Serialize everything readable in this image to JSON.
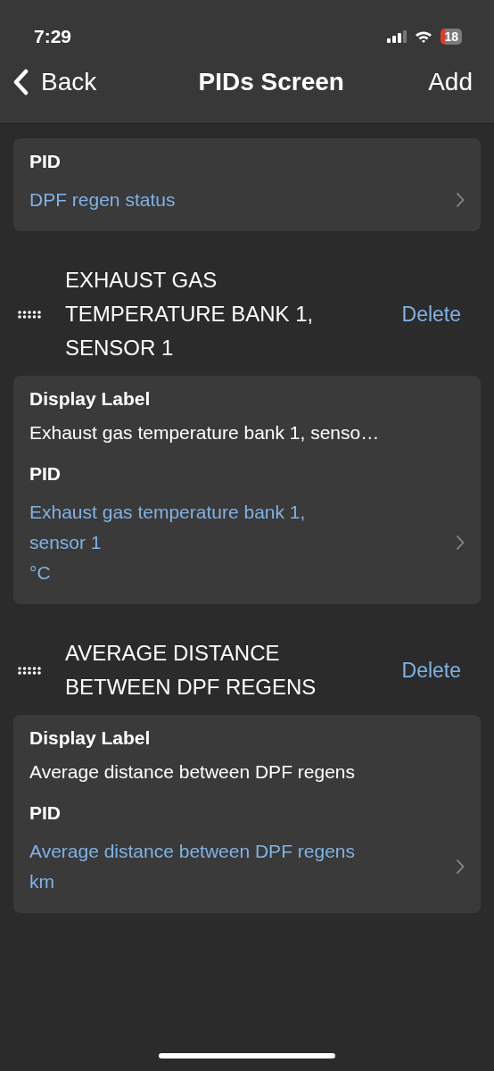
{
  "status_bar": {
    "time": "7:29",
    "battery": "18"
  },
  "nav": {
    "back": "Back",
    "title": "PIDs Screen",
    "action": "Add"
  },
  "sections": [
    {
      "fields": [
        {
          "kind": "link",
          "label": "PID",
          "lines": [
            "DPF regen status"
          ]
        }
      ]
    },
    {
      "title": "EXHAUST GAS TEMPERATURE BANK 1, SENSOR 1",
      "delete": "Delete",
      "fields": [
        {
          "kind": "text",
          "label": "Display Label",
          "value": "Exhaust gas temperature bank 1, senso…"
        },
        {
          "kind": "link",
          "label": "PID",
          "lines": [
            "Exhaust gas temperature bank 1,",
            "sensor 1",
            "°C"
          ]
        }
      ]
    },
    {
      "title": "AVERAGE DISTANCE BETWEEN DPF REGENS",
      "delete": "Delete",
      "fields": [
        {
          "kind": "text",
          "label": "Display Label",
          "value": "Average distance between DPF regens"
        },
        {
          "kind": "link",
          "label": "PID",
          "lines": [
            "Average distance between DPF regens",
            "km"
          ]
        }
      ]
    }
  ]
}
